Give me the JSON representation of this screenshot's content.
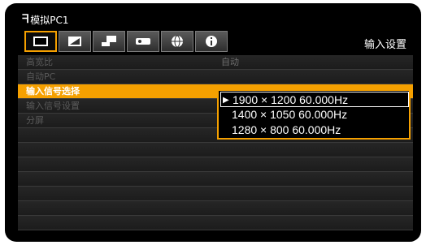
{
  "header": {
    "source_logo": "ᖷ",
    "source_label": "模拟PC1",
    "section_title": "输入设置"
  },
  "tabs": [
    {
      "icon": "screen-icon",
      "active": true
    },
    {
      "icon": "image-adjust-icon",
      "active": false
    },
    {
      "icon": "install-icon",
      "active": false
    },
    {
      "icon": "projector-icon",
      "active": false
    },
    {
      "icon": "network-globe-icon",
      "active": false
    },
    {
      "icon": "info-icon",
      "active": false
    }
  ],
  "menu": [
    {
      "label": "高宽比",
      "value": "自动"
    },
    {
      "label": "自动PC",
      "value": ""
    },
    {
      "label": "输入信号选择",
      "value": ""
    },
    {
      "label": "输入信号设置",
      "value": ""
    },
    {
      "label": "分屏",
      "value": ""
    },
    {
      "label": "",
      "value": ""
    },
    {
      "label": "",
      "value": ""
    },
    {
      "label": "",
      "value": ""
    },
    {
      "label": "",
      "value": ""
    },
    {
      "label": "",
      "value": ""
    },
    {
      "label": "",
      "value": ""
    },
    {
      "label": "",
      "value": ""
    }
  ],
  "dropdown": {
    "arrow": "▶",
    "options": [
      "1900 × 1200 60.000Hz",
      "1400 × 1050 60.000Hz",
      "1280 × 800 60.000Hz"
    ]
  },
  "colors": {
    "accent": "#f5a000"
  }
}
